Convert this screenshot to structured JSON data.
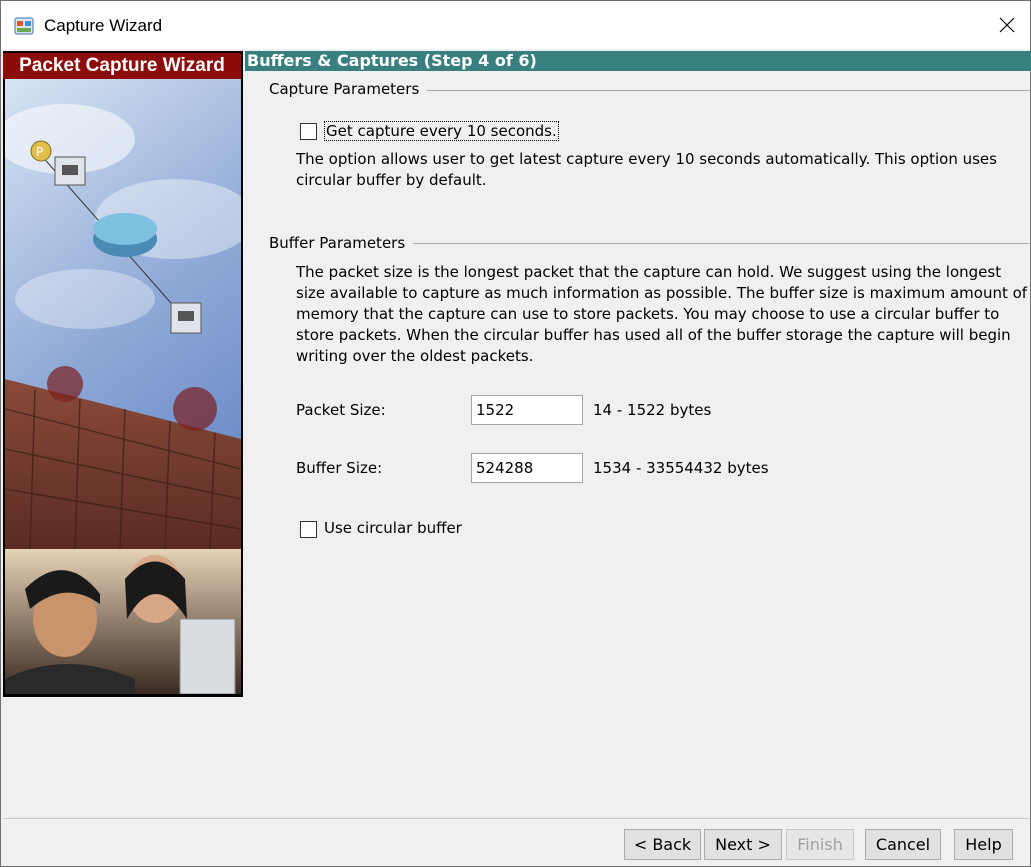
{
  "window": {
    "title": "Capture Wizard",
    "icon": "app-icon",
    "close_icon": "close-icon"
  },
  "left_panel": {
    "banner": "Packet Capture Wizard",
    "art": "wizard-illustration"
  },
  "step_header": "Buffers & Captures  (Step 4 of 6)",
  "capture_parameters": {
    "heading": "Capture Parameters",
    "checkbox_label": "Get capture every 10 seconds.",
    "checked": false,
    "description": "The option allows user to get latest capture every 10 seconds automatically. This option uses circular buffer by default."
  },
  "buffer_parameters": {
    "heading": "Buffer Parameters",
    "description": "The packet size is the longest packet that the capture can hold. We suggest using the longest size available to capture as much information as possible. The buffer size is maximum amount of memory that the capture can use to store packets. You may choose to use a circular buffer to store packets. When the circular buffer has used all of the buffer storage the capture will begin writing over the oldest packets.",
    "packet_size": {
      "label": "Packet Size:",
      "value": "1522",
      "range": "14 - 1522 bytes"
    },
    "buffer_size": {
      "label": "Buffer Size:",
      "value": "524288",
      "range": "1534 - 33554432 bytes"
    },
    "circular_buffer": {
      "label": "Use circular buffer",
      "checked": false
    }
  },
  "buttons": {
    "back": "< Back",
    "next": "Next >",
    "finish": "Finish",
    "cancel": "Cancel",
    "help": "Help"
  }
}
